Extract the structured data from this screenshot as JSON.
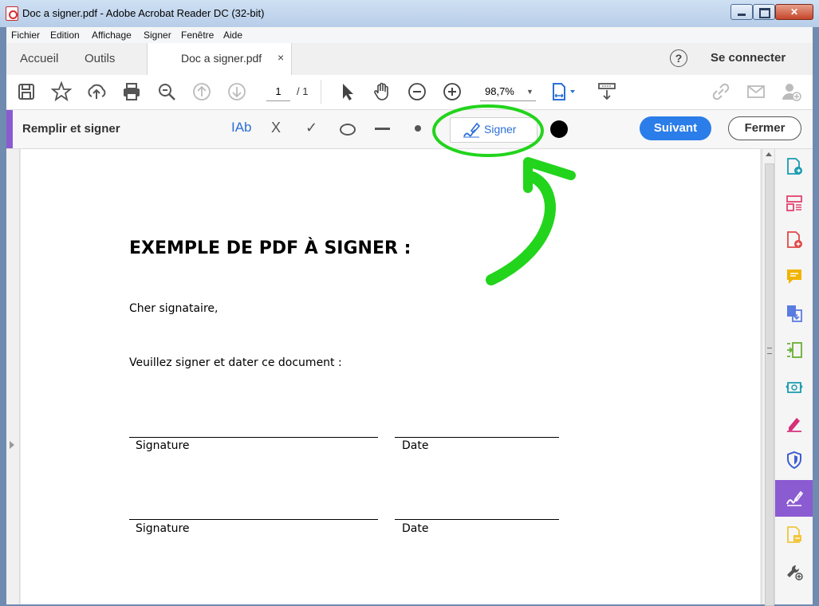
{
  "window": {
    "title": "Doc a signer.pdf - Adobe Acrobat Reader DC (32-bit)",
    "close_glyph": "✕"
  },
  "menu": [
    "Fichier",
    "Edition",
    "Affichage",
    "Signer",
    "Fenêtre",
    "Aide"
  ],
  "tabs": {
    "home": "Accueil",
    "tools": "Outils",
    "document": "Doc a signer.pdf",
    "close_glyph": "×",
    "help_glyph": "?",
    "connect": "Se connecter"
  },
  "toolbar": {
    "page_current": "1",
    "page_total": "/ 1",
    "zoom": "98,7%"
  },
  "fill_sign": {
    "title": "Remplir et signer",
    "text_tool": "IAb",
    "cross_tool": "X",
    "check_tool": "✓",
    "sign_button": "Signer",
    "next_button": "Suivant",
    "close_button": "Fermer"
  },
  "document": {
    "heading": "EXEMPLE DE PDF À SIGNER :",
    "greeting": "Cher signataire,",
    "instruction": "Veuillez signer et dater ce document :",
    "signature_label_1": "Signature",
    "date_label_1": "Date",
    "signature_label_2": "Signature",
    "date_label_2": "Date"
  },
  "colors": {
    "accent_purple": "#8b5bd1",
    "primary_blue": "#2b7de9",
    "highlight_green": "#22d41c"
  },
  "right_panel_icons": [
    "export-pdf-icon",
    "organize-pages-icon",
    "create-pdf-icon",
    "comment-icon",
    "combine-files-icon",
    "edit-pdf-icon",
    "send-for-review-icon",
    "fill-sign-pen-icon",
    "protect-shield-icon",
    "fill-sign-active-icon",
    "more-tools-icon",
    "tools-settings-icon"
  ]
}
